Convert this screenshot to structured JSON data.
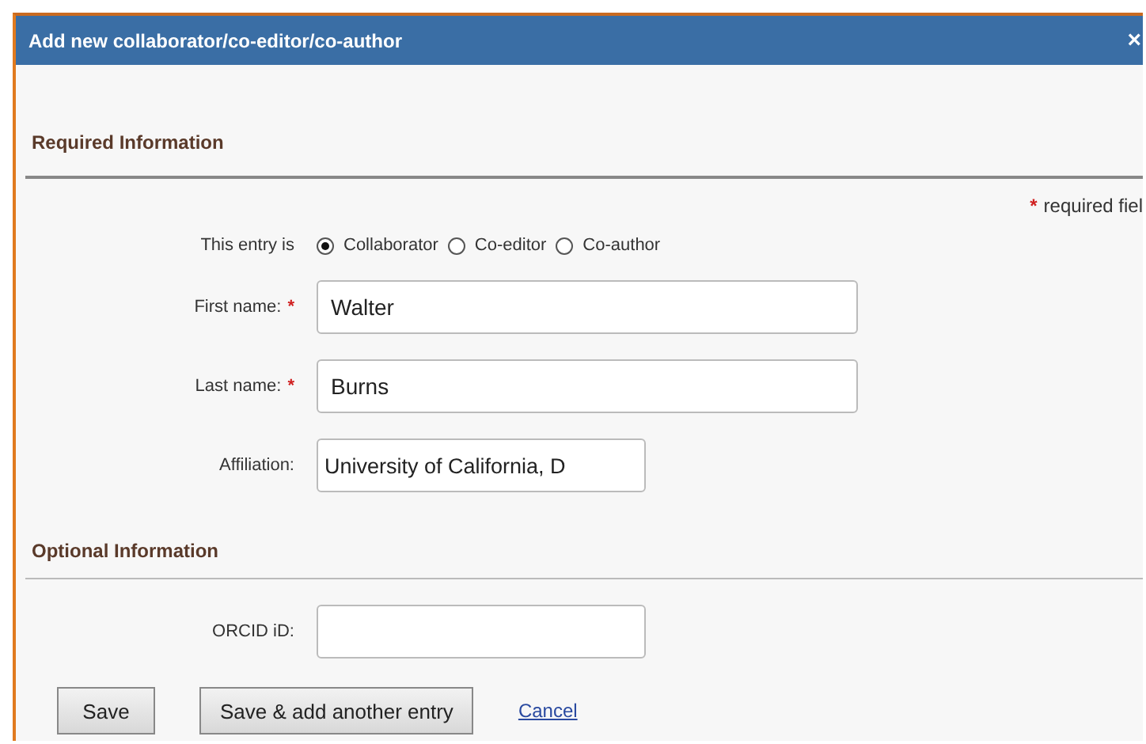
{
  "dialog": {
    "title": "Add new collaborator/co-editor/co-author",
    "close": "×"
  },
  "required_section": {
    "heading": "Required Information",
    "required_mark": "*",
    "required_note": "required fiel"
  },
  "entry_type": {
    "label": "This entry is",
    "options": [
      {
        "label": "Collaborator",
        "selected": true
      },
      {
        "label": "Co-editor",
        "selected": false
      },
      {
        "label": "Co-author",
        "selected": false
      }
    ]
  },
  "required_fields": [
    {
      "label": "First name:",
      "required": true,
      "value": "Walter",
      "kind": "wide"
    },
    {
      "label": "Last name:",
      "required": true,
      "value": "Burns",
      "kind": "wide"
    },
    {
      "label": "Affiliation:",
      "required": false,
      "value": "University of California, D",
      "kind": "narrow"
    }
  ],
  "optional_section": {
    "heading": "Optional Information"
  },
  "optional_fields": [
    {
      "label": "ORCID iD:",
      "required": false,
      "kind": "narrow"
    }
  ],
  "buttons": [
    {
      "label": "Save",
      "kind": "button"
    },
    {
      "label": "Save & add another entry",
      "kind": "button"
    },
    {
      "label": "Cancel",
      "kind": "link"
    }
  ]
}
